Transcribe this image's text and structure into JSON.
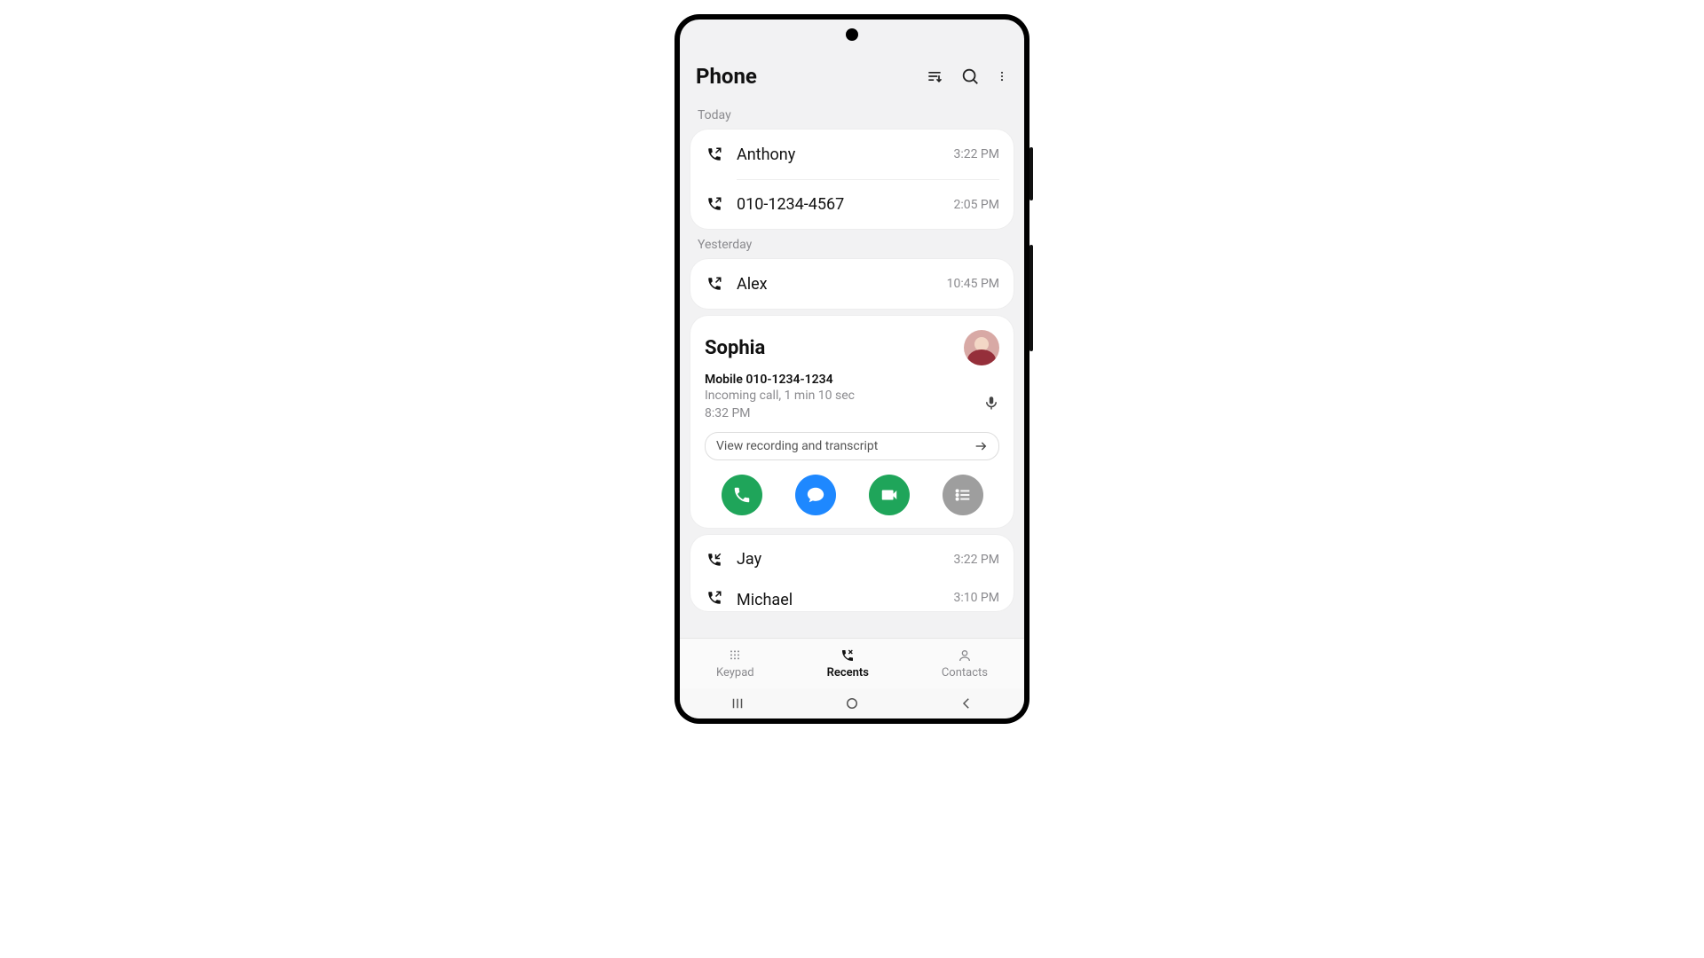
{
  "header": {
    "title": "Phone"
  },
  "sections": {
    "today": "Today",
    "yesterday": "Yesterday"
  },
  "calls": {
    "today": [
      {
        "name": "Anthony",
        "time": "3:22 PM",
        "direction": "outgoing"
      },
      {
        "name": "010-1234-4567",
        "time": "2:05 PM",
        "direction": "outgoing"
      }
    ],
    "yesterday_pre": [
      {
        "name": "Alex",
        "time": "10:45 PM",
        "direction": "outgoing"
      }
    ],
    "yesterday_post": [
      {
        "name": "Jay",
        "time": "3:22 PM",
        "direction": "incoming"
      },
      {
        "name": "Michael",
        "time": "3:10 PM",
        "direction": "outgoing"
      }
    ]
  },
  "detail": {
    "name": "Sophia",
    "phone_label": "Mobile 010-1234-1234",
    "desc": "Incoming call, 1 min 10 sec",
    "time": "8:32 PM",
    "pill_label": "View recording and transcript"
  },
  "tabs": {
    "keypad": "Keypad",
    "recents": "Recents",
    "contacts": "Contacts"
  }
}
